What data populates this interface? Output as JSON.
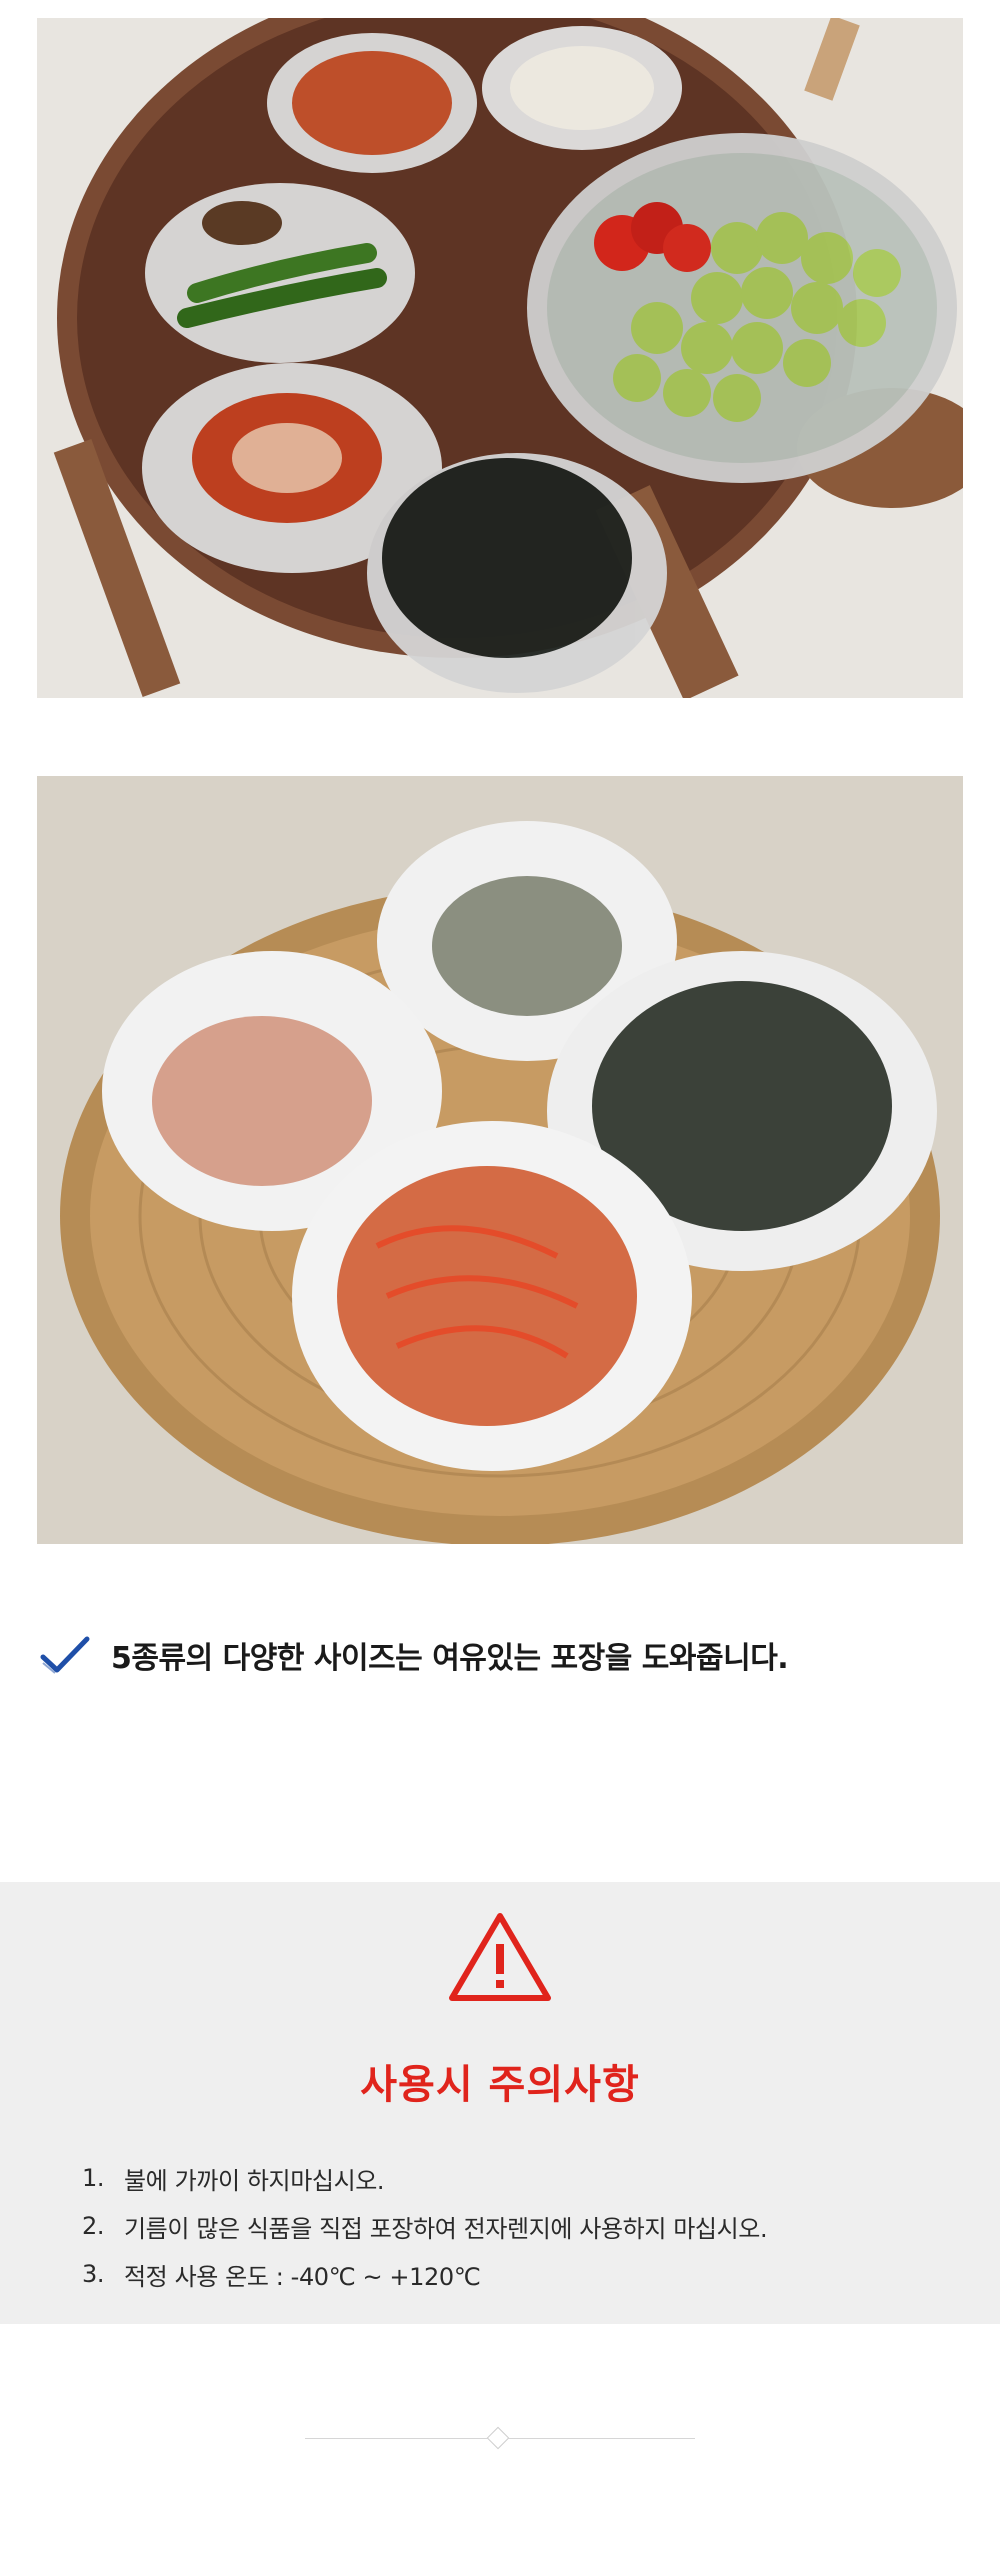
{
  "images": {
    "photo1_label": "table-with-covered-side-dishes",
    "photo2_label": "basket-with-covered-bowls"
  },
  "feature": {
    "icon": "checkmark-icon",
    "text": "5종류의 다양한 사이즈는 여유있는 포장을 도와줍니다."
  },
  "caution": {
    "icon": "warning-icon",
    "title": "사용시 주의사항",
    "items": [
      {
        "num": "1.",
        "text": "불에 가까이 하지마십시오."
      },
      {
        "num": "2.",
        "text": "기름이 많은 식품을 직접 포장하여 전자렌지에 사용하지 마십시오."
      },
      {
        "num": "3.",
        "text": "적정 사용 온도 : -40℃ ~ +120℃"
      }
    ]
  },
  "colors": {
    "accent_red": "#e0241c",
    "check_blue": "#1f4fa8",
    "panel_bg": "#efefef"
  }
}
